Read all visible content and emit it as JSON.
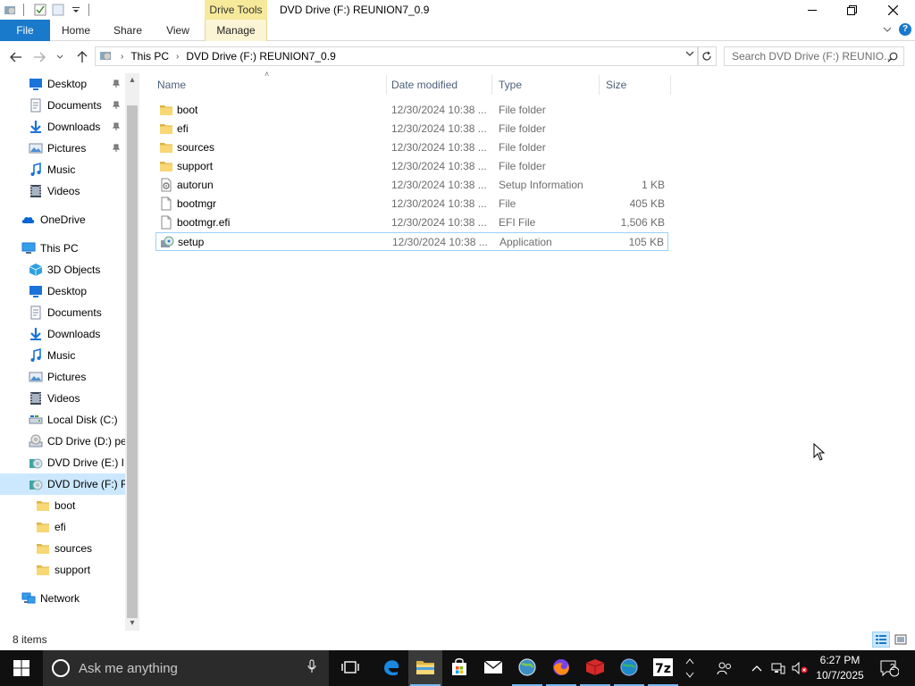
{
  "titlebar": {
    "context_tab_header": "Drive Tools",
    "window_title": "DVD Drive (F:) REUNION7_0.9"
  },
  "ribbon": {
    "tabs": [
      "File",
      "Home",
      "Share",
      "View",
      "Manage"
    ]
  },
  "address": {
    "crumbs": [
      "This PC",
      "DVD Drive (F:) REUNION7_0.9"
    ],
    "search_placeholder": "Search DVD Drive (F:) REUNIO..."
  },
  "navpane": {
    "items": [
      {
        "label": "Desktop",
        "icon": "desktop-icon",
        "pinned": true
      },
      {
        "label": "Documents",
        "icon": "documents-icon",
        "pinned": true
      },
      {
        "label": "Downloads",
        "icon": "downloads-icon",
        "pinned": true
      },
      {
        "label": "Pictures",
        "icon": "pictures-icon",
        "pinned": true
      },
      {
        "label": "Music",
        "icon": "music-icon",
        "pinned": false
      },
      {
        "label": "Videos",
        "icon": "videos-icon",
        "pinned": false
      },
      {
        "label": "OneDrive",
        "icon": "onedrive-icon",
        "pinned": false
      },
      {
        "label": "This PC",
        "icon": "this-pc-icon",
        "pinned": false
      },
      {
        "label": "3D Objects",
        "icon": "3d-objects-icon",
        "pinned": false
      },
      {
        "label": "Desktop",
        "icon": "desktop-icon",
        "pinned": false
      },
      {
        "label": "Documents",
        "icon": "documents-icon",
        "pinned": false
      },
      {
        "label": "Downloads",
        "icon": "downloads-icon",
        "pinned": false
      },
      {
        "label": "Music",
        "icon": "music-icon",
        "pinned": false
      },
      {
        "label": "Pictures",
        "icon": "pictures-icon",
        "pinned": false
      },
      {
        "label": "Videos",
        "icon": "videos-icon",
        "pinned": false
      },
      {
        "label": "Local Disk (C:)",
        "icon": "local-disk-icon",
        "pinned": false
      },
      {
        "label": "CD Drive (D:) pe",
        "icon": "cd-drive-icon",
        "pinned": false
      },
      {
        "label": "DVD Drive (E:) IR",
        "icon": "dvd-drive-icon",
        "pinned": false
      },
      {
        "label": "DVD Drive (F:) RE",
        "icon": "dvd-drive-icon",
        "pinned": false,
        "selected": true
      },
      {
        "label": "boot",
        "icon": "folder-icon",
        "pinned": false
      },
      {
        "label": "efi",
        "icon": "folder-icon",
        "pinned": false
      },
      {
        "label": "sources",
        "icon": "folder-icon",
        "pinned": false
      },
      {
        "label": "support",
        "icon": "folder-icon",
        "pinned": false
      },
      {
        "label": "Network",
        "icon": "network-icon",
        "pinned": false
      }
    ]
  },
  "filelist": {
    "columns": [
      "Name",
      "Date modified",
      "Type",
      "Size"
    ],
    "rows": [
      {
        "name": "boot",
        "date": "12/30/2024 10:38 ...",
        "type": "File folder",
        "size": "",
        "icon": "folder-icon"
      },
      {
        "name": "efi",
        "date": "12/30/2024 10:38 ...",
        "type": "File folder",
        "size": "",
        "icon": "folder-icon"
      },
      {
        "name": "sources",
        "date": "12/30/2024 10:38 ...",
        "type": "File folder",
        "size": "",
        "icon": "folder-icon"
      },
      {
        "name": "support",
        "date": "12/30/2024 10:38 ...",
        "type": "File folder",
        "size": "",
        "icon": "folder-icon"
      },
      {
        "name": "autorun",
        "date": "12/30/2024 10:38 ...",
        "type": "Setup Information",
        "size": "1 KB",
        "icon": "setup-info-file-icon"
      },
      {
        "name": "bootmgr",
        "date": "12/30/2024 10:38 ...",
        "type": "File",
        "size": "405 KB",
        "icon": "file-icon"
      },
      {
        "name": "bootmgr.efi",
        "date": "12/30/2024 10:38 ...",
        "type": "EFI File",
        "size": "1,506 KB",
        "icon": "file-icon"
      },
      {
        "name": "setup",
        "date": "12/30/2024 10:38 ...",
        "type": "Application",
        "size": "105 KB",
        "icon": "setup-app-icon",
        "selected": true
      }
    ]
  },
  "statusbar": {
    "item_count": "8 items"
  },
  "taskbar": {
    "search_placeholder": "Ask me anything",
    "apps": [
      "task-view-icon",
      "edge-icon",
      "file-explorer-icon",
      "store-icon",
      "mail-icon",
      "app-globe-icon",
      "firefox-icon",
      "app-red-icon",
      "app-blue-globe-icon",
      "7zip-icon"
    ],
    "time": "6:27 PM",
    "date": "10/7/2025",
    "notification_count": "2"
  },
  "colors": {
    "accent": "#1979ca",
    "selection_bg": "#cce8ff",
    "selection_border": "#99d1ff",
    "context_tab": "#f6e99a",
    "folder": "#f8d775",
    "taskbar": "#101010"
  }
}
